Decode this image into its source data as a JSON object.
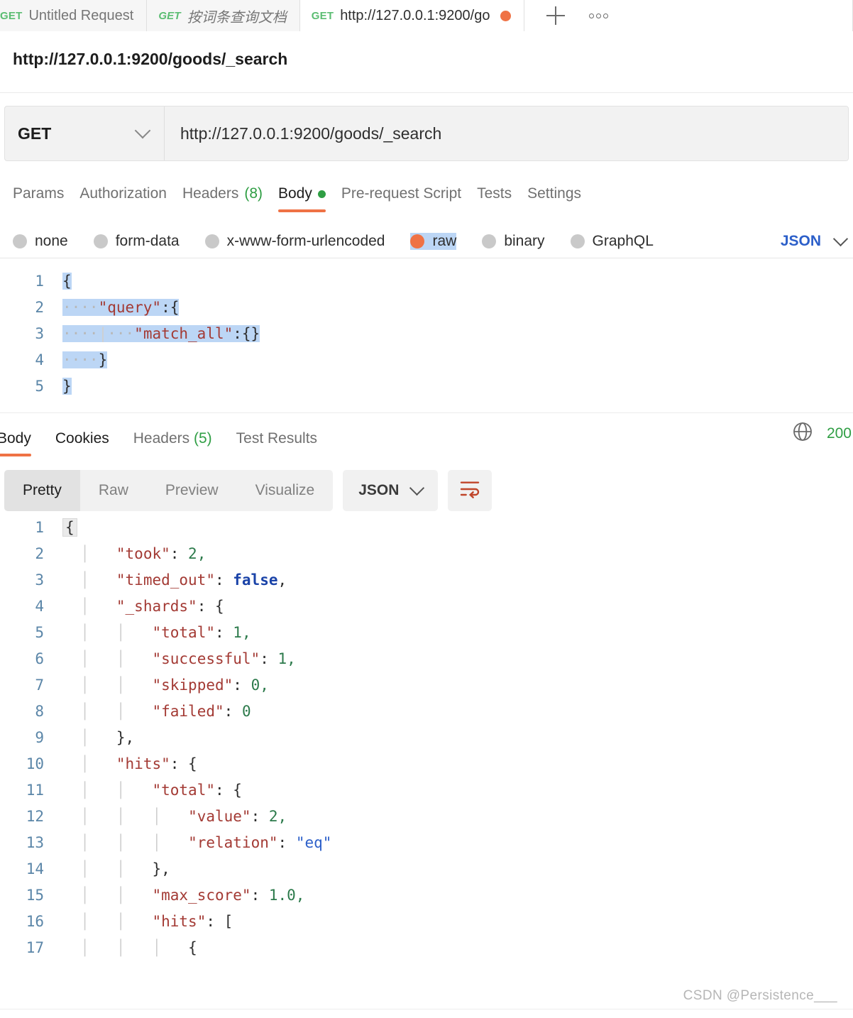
{
  "tabs": [
    {
      "method": "GET",
      "label": "Untitled Request",
      "state": "inactive"
    },
    {
      "method": "GET",
      "label": "按词条查询文档",
      "state": "inactive"
    },
    {
      "method": "GET",
      "label": "http://127.0.0.1:9200/go",
      "state": "active"
    }
  ],
  "tab_actions": {
    "new_tab": "+",
    "more": "•••"
  },
  "request": {
    "title": "http://127.0.0.1:9200/goods/_search",
    "method": "GET",
    "url": "http://127.0.0.1:9200/goods/_search",
    "tabs": [
      {
        "label": "Params",
        "count": "",
        "active": false
      },
      {
        "label": "Authorization",
        "count": "",
        "active": false
      },
      {
        "label": "Headers",
        "count": "(8)",
        "active": false
      },
      {
        "label": "Body",
        "count": "",
        "active": true
      },
      {
        "label": "Pre-request Script",
        "count": "",
        "active": false
      },
      {
        "label": "Tests",
        "count": "",
        "active": false
      },
      {
        "label": "Settings",
        "count": "",
        "active": false
      }
    ],
    "body_types": [
      {
        "label": "none",
        "selected": false
      },
      {
        "label": "form-data",
        "selected": false
      },
      {
        "label": "x-www-form-urlencoded",
        "selected": false
      },
      {
        "label": "raw",
        "selected": true
      },
      {
        "label": "binary",
        "selected": false
      },
      {
        "label": "GraphQL",
        "selected": false
      }
    ],
    "format_label": "JSON",
    "body_lines": [
      {
        "n": "1",
        "text": "{"
      },
      {
        "n": "2",
        "text": "····\"query\":{"
      },
      {
        "n": "3",
        "text": "····|····\"match_all\":{}"
      },
      {
        "n": "4",
        "text": "····}"
      },
      {
        "n": "5",
        "text": "}"
      }
    ]
  },
  "response": {
    "tabs": [
      {
        "label": "Body",
        "count": "",
        "active": true
      },
      {
        "label": "Cookies",
        "count": "",
        "active": false
      },
      {
        "label": "Headers",
        "count": "(5)",
        "active": false
      },
      {
        "label": "Test Results",
        "count": "",
        "active": false
      }
    ],
    "status_code": "200",
    "globe_icon": "globe-icon",
    "view_modes": [
      {
        "label": "Pretty",
        "active": true
      },
      {
        "label": "Raw",
        "active": false
      },
      {
        "label": "Preview",
        "active": false
      },
      {
        "label": "Visualize",
        "active": false
      }
    ],
    "format_label": "JSON",
    "wrap_icon": "wrap-lines-icon",
    "body_lines": [
      {
        "n": "1",
        "indent": 0,
        "key": "",
        "value": "{",
        "vtype": "punct"
      },
      {
        "n": "2",
        "indent": 1,
        "key": "\"took\"",
        "value": "2,",
        "vtype": "num"
      },
      {
        "n": "3",
        "indent": 1,
        "key": "\"timed_out\"",
        "value": "false,",
        "vtype": "bool"
      },
      {
        "n": "4",
        "indent": 1,
        "key": "\"_shards\"",
        "value": "{",
        "vtype": "punct"
      },
      {
        "n": "5",
        "indent": 2,
        "key": "\"total\"",
        "value": "1,",
        "vtype": "num"
      },
      {
        "n": "6",
        "indent": 2,
        "key": "\"successful\"",
        "value": "1,",
        "vtype": "num"
      },
      {
        "n": "7",
        "indent": 2,
        "key": "\"skipped\"",
        "value": "0,",
        "vtype": "num"
      },
      {
        "n": "8",
        "indent": 2,
        "key": "\"failed\"",
        "value": "0",
        "vtype": "num"
      },
      {
        "n": "9",
        "indent": 1,
        "key": "",
        "value": "},",
        "vtype": "punct"
      },
      {
        "n": "10",
        "indent": 1,
        "key": "\"hits\"",
        "value": "{",
        "vtype": "punct"
      },
      {
        "n": "11",
        "indent": 2,
        "key": "\"total\"",
        "value": "{",
        "vtype": "punct"
      },
      {
        "n": "12",
        "indent": 3,
        "key": "\"value\"",
        "value": "2,",
        "vtype": "num"
      },
      {
        "n": "13",
        "indent": 3,
        "key": "\"relation\"",
        "value": "\"eq\"",
        "vtype": "str"
      },
      {
        "n": "14",
        "indent": 2,
        "key": "",
        "value": "},",
        "vtype": "punct"
      },
      {
        "n": "15",
        "indent": 2,
        "key": "\"max_score\"",
        "value": "1.0,",
        "vtype": "num"
      },
      {
        "n": "16",
        "indent": 2,
        "key": "\"hits\"",
        "value": "[",
        "vtype": "punct"
      },
      {
        "n": "17",
        "indent": 3,
        "key": "",
        "value": "{",
        "vtype": "punct"
      }
    ]
  },
  "watermark": "CSDN @Persistence___",
  "colors": {
    "accent_orange": "#EF7245",
    "green": "#2F9E44",
    "blue": "#2C5FC9",
    "key_red": "#A33A34",
    "selection_blue": "#BCD6F5"
  }
}
